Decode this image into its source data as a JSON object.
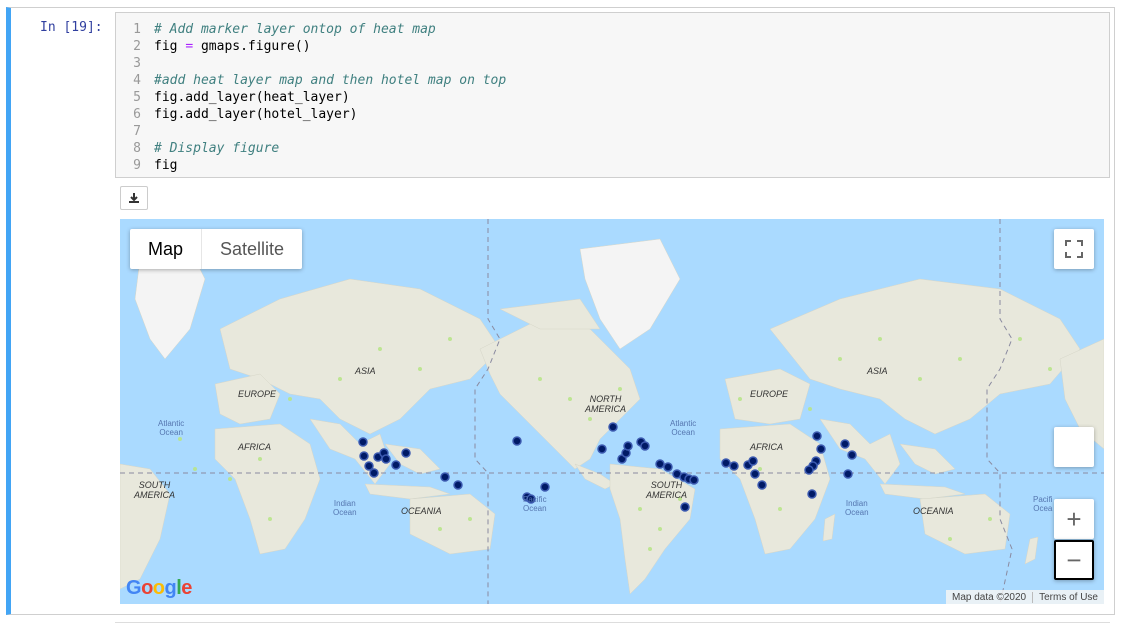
{
  "cell": {
    "prompt": "In [19]:",
    "lines": [
      {
        "n": "1",
        "comment": "# Add marker layer ontop of heat map",
        "code": ""
      },
      {
        "n": "2",
        "code_a": "fig ",
        "op": "=",
        "code_b": " gmaps.figure()"
      },
      {
        "n": "3",
        "code": ""
      },
      {
        "n": "4",
        "comment": "#add heat layer map and then hotel map on top",
        "code": ""
      },
      {
        "n": "5",
        "code": "fig.add_layer(heat_layer)"
      },
      {
        "n": "6",
        "code": "fig.add_layer(hotel_layer)"
      },
      {
        "n": "7",
        "code": ""
      },
      {
        "n": "8",
        "comment": "# Display figure",
        "code": ""
      },
      {
        "n": "9",
        "code": "fig"
      }
    ]
  },
  "download_icon": "download-icon",
  "map": {
    "type_map": "Map",
    "type_satellite": "Satellite",
    "labels": {
      "asia1": "ASIA",
      "europe1": "EUROPE",
      "africa1": "AFRICA",
      "atlantic1a": "Atlantic",
      "atlantic1b": "Ocean",
      "south_america1a": "SOUTH",
      "south_america1b": "AMERICA",
      "indian1a": "Indian",
      "indian1b": "Ocean",
      "oceania1": "OCEANIA",
      "north_america_a": "NORTH",
      "north_america_b": "AMERICA",
      "pacific_a": "Pacific",
      "pacific_b": "Ocean",
      "atlantic2a": "Atlantic",
      "atlantic2b": "Ocean",
      "south_america2a": "SOUTH",
      "south_america2b": "AMERICA",
      "europe2": "EUROPE",
      "africa2": "AFRICA",
      "asia2": "ASIA",
      "indian2a": "Indian",
      "indian2b": "Ocean",
      "oceania2": "OCEANIA",
      "pacific2a": "Pacifi",
      "pacific2b": "Ocea"
    },
    "attribution_data": "Map data ©2020",
    "attribution_terms": "Terms of Use",
    "google": "Google",
    "fullscreen_icon": "fullscreen-icon",
    "zoom_in": "+",
    "zoom_out": "−",
    "colors": {
      "water": "#aadaff",
      "land": "#e8e8dc",
      "green": "#cde9b4",
      "marker": "#001a66"
    }
  }
}
